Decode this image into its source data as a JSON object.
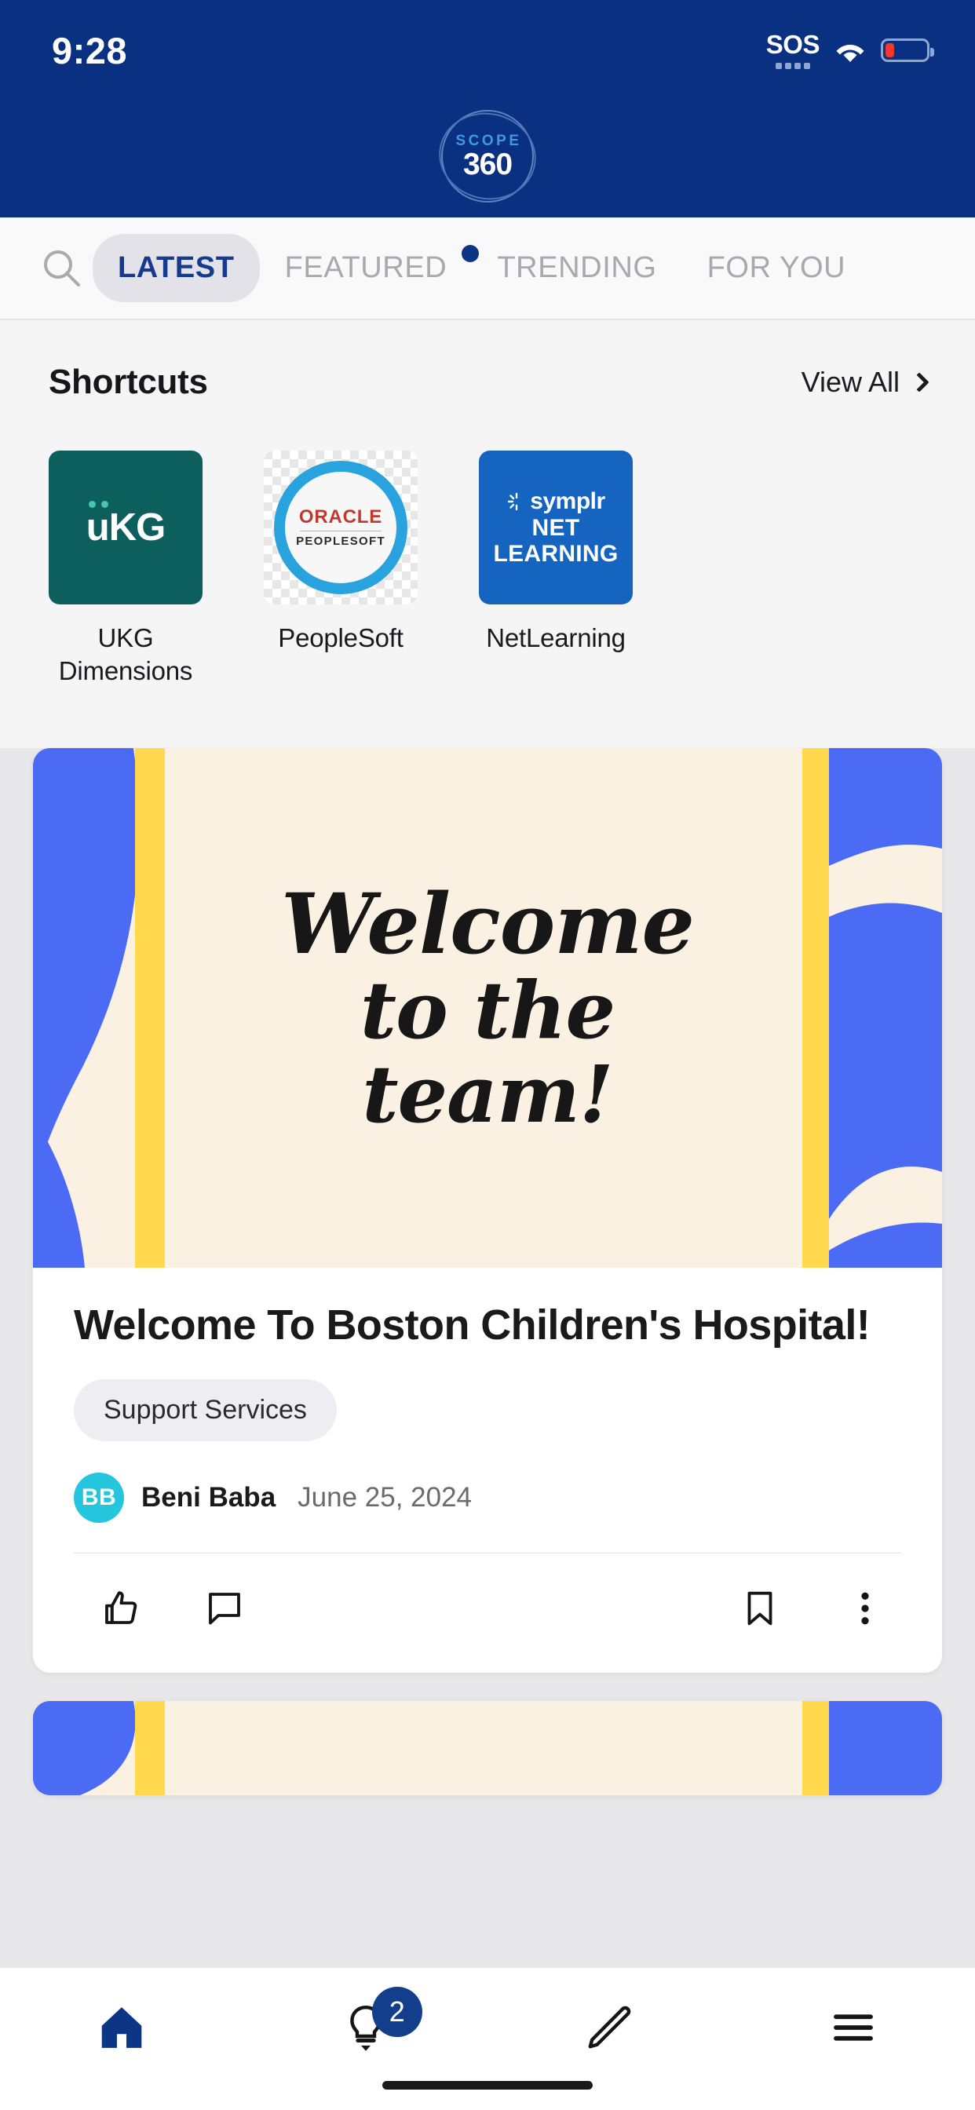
{
  "status_bar": {
    "time": "9:28",
    "sos_label": "SOS",
    "wifi_icon": "wifi-icon",
    "battery_icon": "battery-low-icon"
  },
  "header": {
    "logo_top": "SCOPE",
    "logo_bottom": "360"
  },
  "tabs": {
    "search_icon": "search-icon",
    "items": [
      {
        "label": "LATEST",
        "active": true,
        "dot": false
      },
      {
        "label": "FEATURED",
        "active": false,
        "dot": true
      },
      {
        "label": "TRENDING",
        "active": false,
        "dot": false
      },
      {
        "label": "FOR YOU",
        "active": false,
        "dot": false
      }
    ]
  },
  "shortcuts": {
    "title": "Shortcuts",
    "view_all_label": "View All",
    "view_all_icon": "chevron-right-icon",
    "tiles": [
      {
        "label": "UKG Dimensions",
        "logo_text": "KG",
        "icon_name": "ukg-dimensions-icon",
        "bg": "#0c5f5c"
      },
      {
        "label": "PeopleSoft",
        "logo_text": "ORACLE",
        "logo_subtext": "PEOPLESOFT",
        "icon_name": "oracle-peoplesoft-icon",
        "bg": "#28a3dd"
      },
      {
        "label": "NetLearning",
        "logo_text": "symplr",
        "logo_line1": "NET",
        "logo_line2": "LEARNING",
        "icon_name": "symplr-netlearning-icon",
        "bg": "#1565c0"
      }
    ]
  },
  "feed": {
    "posts": [
      {
        "banner_line1": "Welcome",
        "banner_line2": "to the",
        "banner_line3": "team!",
        "banner_colors": {
          "background": "#fbf1e3",
          "accent_blue": "#4c6bf5",
          "accent_yellow": "#ffd84d"
        },
        "title": "Welcome To Boston Children's Hospital!",
        "tag": "Support Services",
        "author_initials": "BB",
        "author_name": "Beni Baba",
        "date": "June 25, 2024",
        "avatar_color": "#23c6dc",
        "actions": [
          {
            "name": "like-button",
            "icon": "thumbs-up-icon"
          },
          {
            "name": "comment-button",
            "icon": "comment-icon"
          },
          {
            "name": "save-button",
            "icon": "bookmark-icon"
          },
          {
            "name": "more-button",
            "icon": "more-vertical-icon"
          }
        ]
      }
    ]
  },
  "bottom_nav": {
    "items": [
      {
        "name": "nav-home",
        "icon": "home-icon",
        "active": true,
        "badge": null
      },
      {
        "name": "nav-ideas",
        "icon": "lightbulb-sparkle-icon",
        "active": false,
        "badge": "2"
      },
      {
        "name": "nav-compose",
        "icon": "pencil-icon",
        "active": false,
        "badge": null
      },
      {
        "name": "nav-menu",
        "icon": "hamburger-menu-icon",
        "active": false,
        "badge": null
      }
    ],
    "badge_color": "#123e8c",
    "active_color": "#0d3585"
  }
}
